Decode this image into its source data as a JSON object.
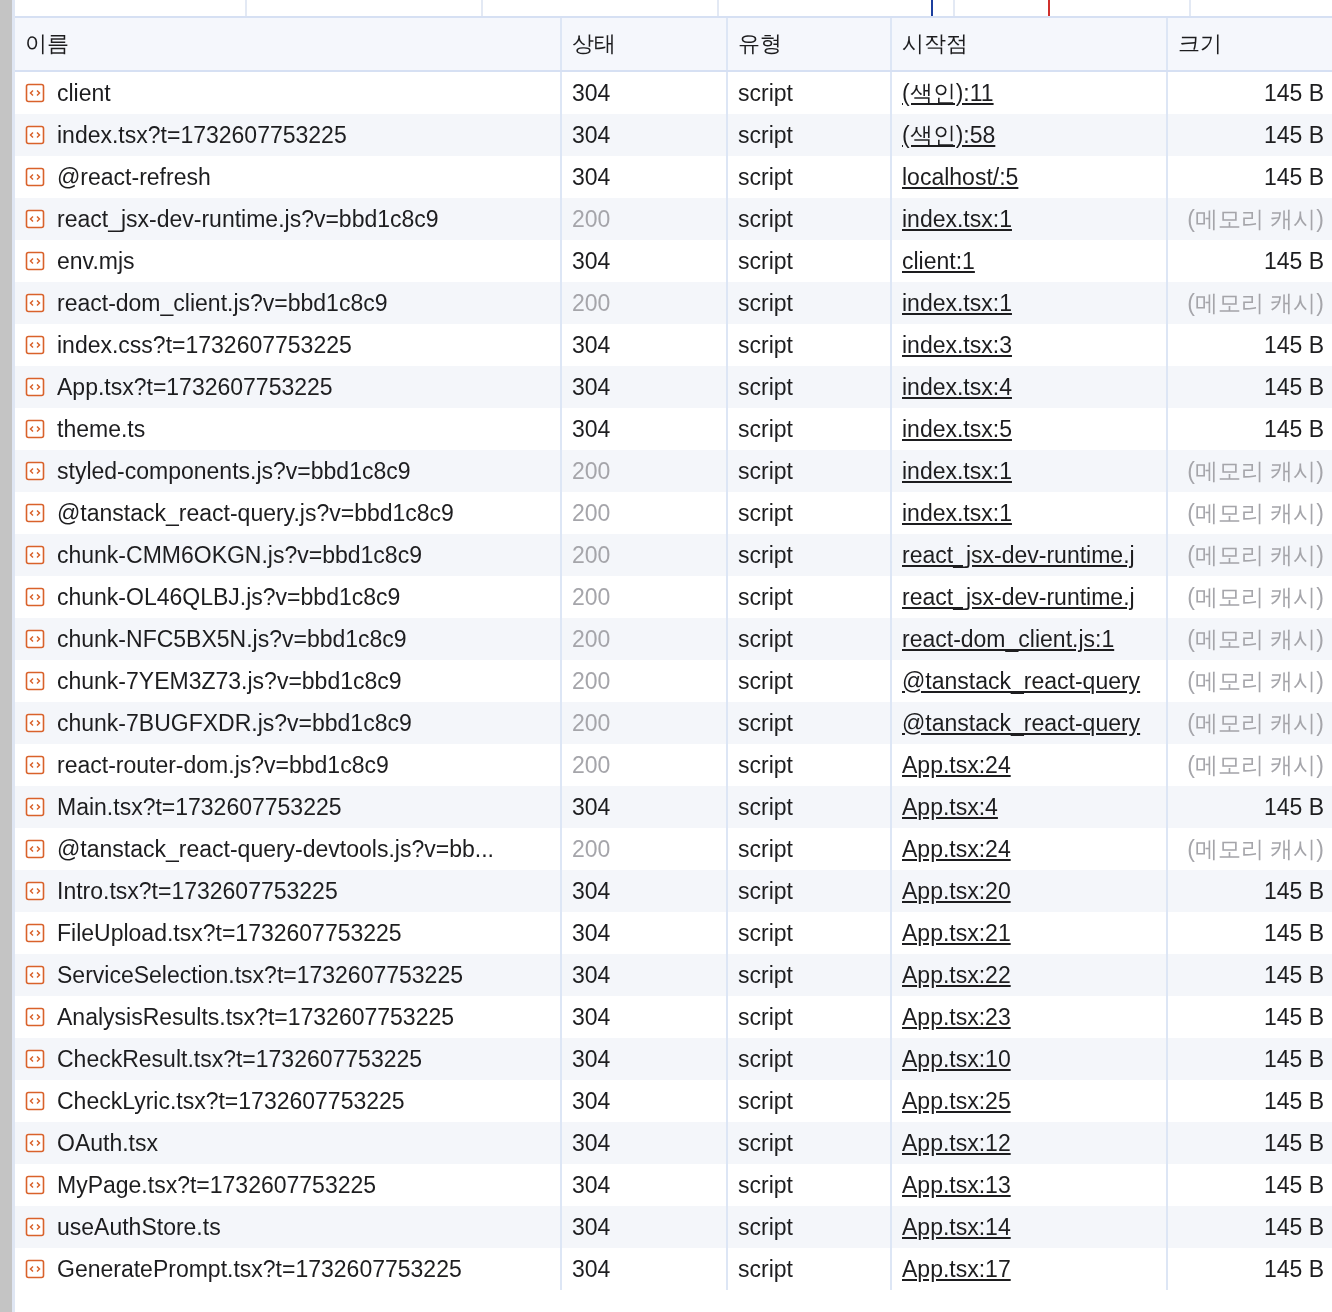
{
  "table": {
    "columns": [
      "이름",
      "상태",
      "유형",
      "시작점",
      "크기"
    ],
    "rows": [
      {
        "name": "client",
        "status": "304",
        "type": "script",
        "initiator": "(색인):11",
        "size": "145 B",
        "cached": false
      },
      {
        "name": "index.tsx?t=1732607753225",
        "status": "304",
        "type": "script",
        "initiator": "(색인):58",
        "size": "145 B",
        "cached": false
      },
      {
        "name": "@react-refresh",
        "status": "304",
        "type": "script",
        "initiator": "localhost/:5",
        "size": "145 B",
        "cached": false
      },
      {
        "name": "react_jsx-dev-runtime.js?v=bbd1c8c9",
        "status": "200",
        "type": "script",
        "initiator": "index.tsx:1",
        "size": "(메모리 캐시)",
        "cached": true
      },
      {
        "name": "env.mjs",
        "status": "304",
        "type": "script",
        "initiator": "client:1",
        "size": "145 B",
        "cached": false
      },
      {
        "name": "react-dom_client.js?v=bbd1c8c9",
        "status": "200",
        "type": "script",
        "initiator": "index.tsx:1",
        "size": "(메모리 캐시)",
        "cached": true
      },
      {
        "name": "index.css?t=1732607753225",
        "status": "304",
        "type": "script",
        "initiator": "index.tsx:3",
        "size": "145 B",
        "cached": false
      },
      {
        "name": "App.tsx?t=1732607753225",
        "status": "304",
        "type": "script",
        "initiator": "index.tsx:4",
        "size": "145 B",
        "cached": false
      },
      {
        "name": "theme.ts",
        "status": "304",
        "type": "script",
        "initiator": "index.tsx:5",
        "size": "145 B",
        "cached": false
      },
      {
        "name": "styled-components.js?v=bbd1c8c9",
        "status": "200",
        "type": "script",
        "initiator": "index.tsx:1",
        "size": "(메모리 캐시)",
        "cached": true
      },
      {
        "name": "@tanstack_react-query.js?v=bbd1c8c9",
        "status": "200",
        "type": "script",
        "initiator": "index.tsx:1",
        "size": "(메모리 캐시)",
        "cached": true
      },
      {
        "name": "chunk-CMM6OKGN.js?v=bbd1c8c9",
        "status": "200",
        "type": "script",
        "initiator": "react_jsx-dev-runtime.j",
        "size": "(메모리 캐시)",
        "cached": true
      },
      {
        "name": "chunk-OL46QLBJ.js?v=bbd1c8c9",
        "status": "200",
        "type": "script",
        "initiator": "react_jsx-dev-runtime.j",
        "size": "(메모리 캐시)",
        "cached": true
      },
      {
        "name": "chunk-NFC5BX5N.js?v=bbd1c8c9",
        "status": "200",
        "type": "script",
        "initiator": "react-dom_client.js:1",
        "size": "(메모리 캐시)",
        "cached": true
      },
      {
        "name": "chunk-7YEM3Z73.js?v=bbd1c8c9",
        "status": "200",
        "type": "script",
        "initiator": "@tanstack_react-query",
        "size": "(메모리 캐시)",
        "cached": true
      },
      {
        "name": "chunk-7BUGFXDR.js?v=bbd1c8c9",
        "status": "200",
        "type": "script",
        "initiator": "@tanstack_react-query",
        "size": "(메모리 캐시)",
        "cached": true
      },
      {
        "name": "react-router-dom.js?v=bbd1c8c9",
        "status": "200",
        "type": "script",
        "initiator": "App.tsx:24",
        "size": "(메모리 캐시)",
        "cached": true
      },
      {
        "name": "Main.tsx?t=1732607753225",
        "status": "304",
        "type": "script",
        "initiator": "App.tsx:4",
        "size": "145 B",
        "cached": false
      },
      {
        "name": "@tanstack_react-query-devtools.js?v=bb...",
        "status": "200",
        "type": "script",
        "initiator": "App.tsx:24",
        "size": "(메모리 캐시)",
        "cached": true
      },
      {
        "name": "Intro.tsx?t=1732607753225",
        "status": "304",
        "type": "script",
        "initiator": "App.tsx:20",
        "size": "145 B",
        "cached": false
      },
      {
        "name": "FileUpload.tsx?t=1732607753225",
        "status": "304",
        "type": "script",
        "initiator": "App.tsx:21",
        "size": "145 B",
        "cached": false
      },
      {
        "name": "ServiceSelection.tsx?t=1732607753225",
        "status": "304",
        "type": "script",
        "initiator": "App.tsx:22",
        "size": "145 B",
        "cached": false
      },
      {
        "name": "AnalysisResults.tsx?t=1732607753225",
        "status": "304",
        "type": "script",
        "initiator": "App.tsx:23",
        "size": "145 B",
        "cached": false
      },
      {
        "name": "CheckResult.tsx?t=1732607753225",
        "status": "304",
        "type": "script",
        "initiator": "App.tsx:10",
        "size": "145 B",
        "cached": false
      },
      {
        "name": "CheckLyric.tsx?t=1732607753225",
        "status": "304",
        "type": "script",
        "initiator": "App.tsx:25",
        "size": "145 B",
        "cached": false
      },
      {
        "name": "OAuth.tsx",
        "status": "304",
        "type": "script",
        "initiator": "App.tsx:12",
        "size": "145 B",
        "cached": false
      },
      {
        "name": "MyPage.tsx?t=1732607753225",
        "status": "304",
        "type": "script",
        "initiator": "App.tsx:13",
        "size": "145 B",
        "cached": false
      },
      {
        "name": "useAuthStore.ts",
        "status": "304",
        "type": "script",
        "initiator": "App.tsx:14",
        "size": "145 B",
        "cached": false
      },
      {
        "name": "GeneratePrompt.tsx?t=1732607753225",
        "status": "304",
        "type": "script",
        "initiator": "App.tsx:17",
        "size": "145 B",
        "cached": false
      }
    ]
  }
}
